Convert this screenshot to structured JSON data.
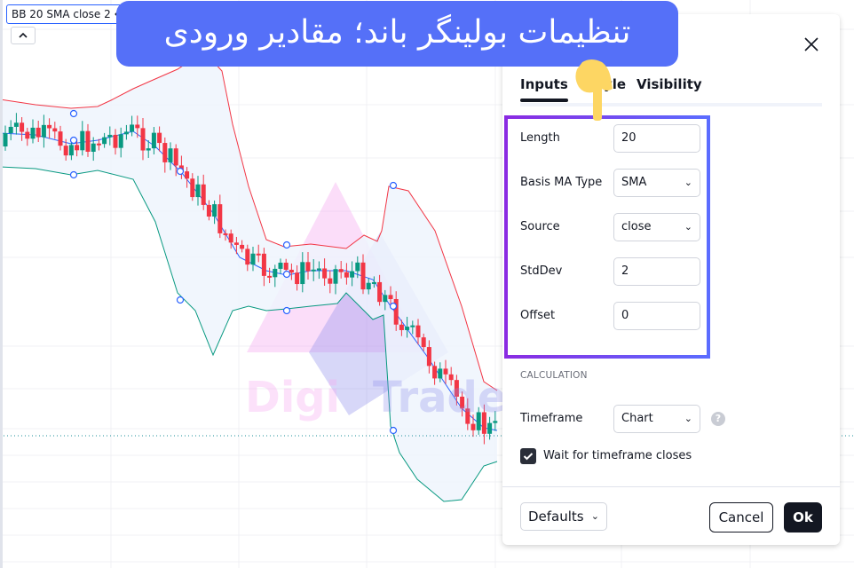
{
  "chart": {
    "legend_label": "BB 20 SMA close 2",
    "watermark": [
      "Digi",
      "Traderz.com"
    ],
    "colors": {
      "up_candle": "#089981",
      "down_candle": "#f23645",
      "basis": "#2962ff",
      "upper_band": "#f23645",
      "lower_band": "#089981",
      "band_fill": "#eef4fd",
      "grid": "#f0f1f4",
      "last_price_line": "#1e8f9a"
    }
  },
  "annotation": {
    "banner_text": "تنظیمات بولینگر باند؛ مقادیر ورودی",
    "banner_color": "#5570f8",
    "pointer_color": "#fdd663"
  },
  "dialog": {
    "tabs": [
      {
        "label": "Inputs",
        "active": true
      },
      {
        "label": "Style",
        "active": false
      },
      {
        "label": "Visibility",
        "active": false
      }
    ],
    "inputs": [
      {
        "label": "Length",
        "value": "20",
        "type": "number"
      },
      {
        "label": "Basis MA Type",
        "value": "SMA",
        "type": "select"
      },
      {
        "label": "Source",
        "value": "close",
        "type": "select"
      },
      {
        "label": "StdDev",
        "value": "2",
        "type": "number"
      },
      {
        "label": "Offset",
        "value": "0",
        "type": "number"
      }
    ],
    "calculation_title": "CALCULATION",
    "timeframe": {
      "label": "Timeframe",
      "value": "Chart"
    },
    "help_icon": "?",
    "wait_checkbox": {
      "label": "Wait for timeframe closes",
      "checked": true
    },
    "footer": {
      "defaults_label": "Defaults",
      "cancel_label": "Cancel",
      "ok_label": "Ok"
    }
  }
}
